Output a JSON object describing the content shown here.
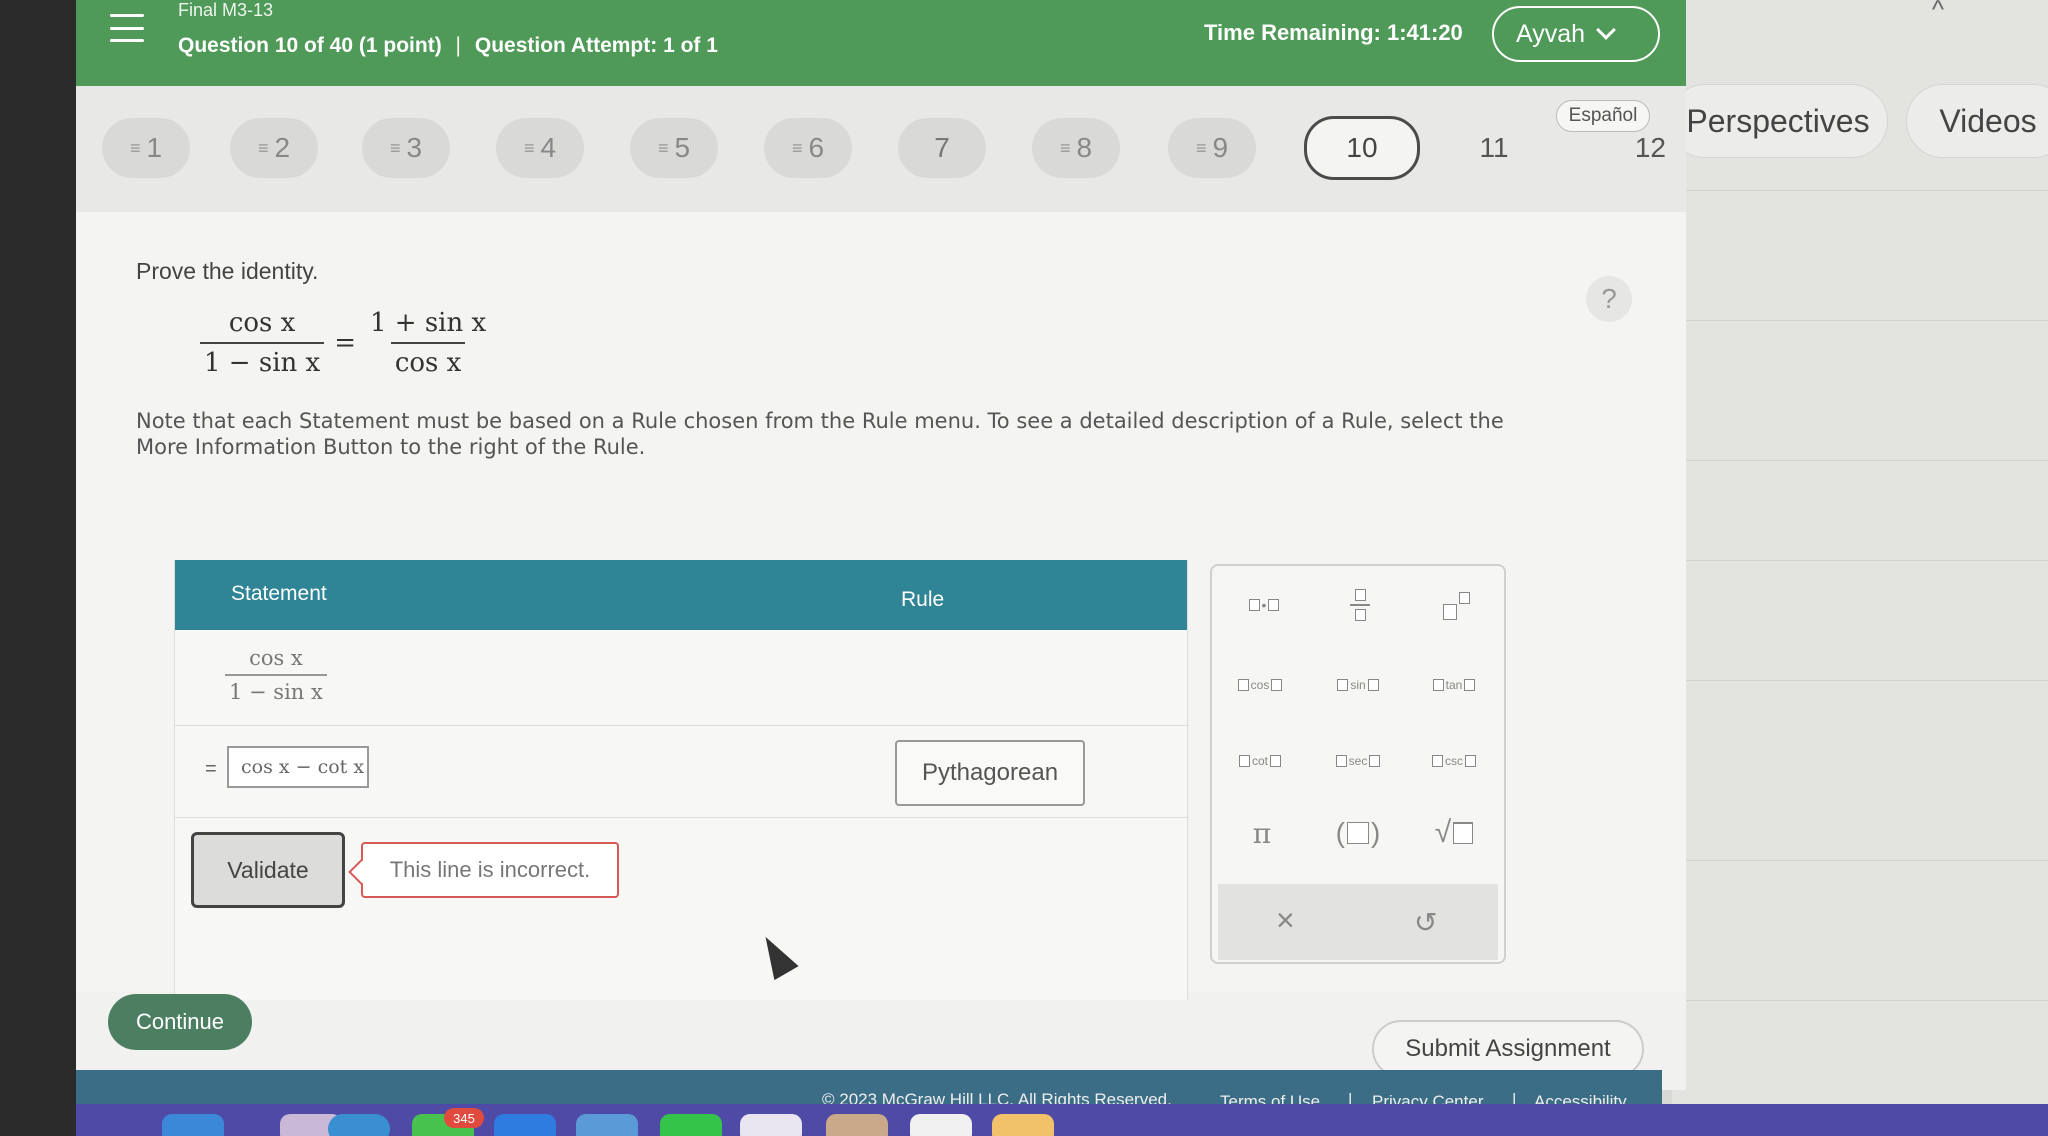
{
  "header": {
    "assignment_title": "Final M3-13",
    "question_info": "Question 10 of 40 (1 point)",
    "attempt_info": "Question Attempt: 1 of 1",
    "separator": "|",
    "time_remaining": "Time Remaining: 1:41:20",
    "user_name": "Ayvah"
  },
  "question_nav": {
    "items": [
      {
        "label": "1",
        "answered": true
      },
      {
        "label": "2",
        "answered": true
      },
      {
        "label": "3",
        "answered": true
      },
      {
        "label": "4",
        "answered": true
      },
      {
        "label": "5",
        "answered": true
      },
      {
        "label": "6",
        "answered": true
      },
      {
        "label": "7",
        "answered": false
      },
      {
        "label": "8",
        "answered": true
      },
      {
        "label": "9",
        "answered": true
      },
      {
        "label": "10",
        "current": true
      },
      {
        "label": "11"
      },
      {
        "label": "12"
      }
    ],
    "answered_icon": "≡",
    "language_label": "Español"
  },
  "side_panel": {
    "tabs": [
      "Perspectives",
      "Videos"
    ]
  },
  "problem": {
    "prompt": "Prove the identity.",
    "identity": {
      "lhs_num": "cos x",
      "lhs_den": "1 − sin x",
      "equals": "=",
      "rhs_num": "1 + sin x",
      "rhs_den": "cos x"
    },
    "note": "Note that each Statement must be based on a Rule chosen from the Rule menu. To see a detailed description of a Rule, select the More Information Button to the right of the Rule.",
    "help_symbol": "?"
  },
  "proof_table": {
    "header_statement": "Statement",
    "header_rule": "Rule",
    "row1": {
      "num": "cos x",
      "den": "1 − sin x"
    },
    "row2": {
      "equals": "=",
      "statement": "cos x − cot x",
      "rule": "Pythagorean"
    },
    "validate_label": "Validate",
    "feedback": "This line is incorrect."
  },
  "palette": {
    "row2": [
      "cos",
      "sin",
      "tan"
    ],
    "row3": [
      "cot",
      "sec",
      "csc"
    ],
    "pi": "π",
    "clear": "×",
    "undo": "↺"
  },
  "actions": {
    "continue": "Continue",
    "submit": "Submit Assignment"
  },
  "footer": {
    "copyright": "© 2023 McGraw Hill LLC. All Rights Reserved.",
    "links": [
      "Terms of Use",
      "Privacy Center",
      "Accessibility"
    ],
    "separator": "|"
  },
  "dock": {
    "badge": "345"
  },
  "colors": {
    "topbar": "#4f9a58",
    "table_header": "#2f8495",
    "footer": "#3c6d86",
    "error_border": "#d95858",
    "continue": "#4c7f62"
  }
}
